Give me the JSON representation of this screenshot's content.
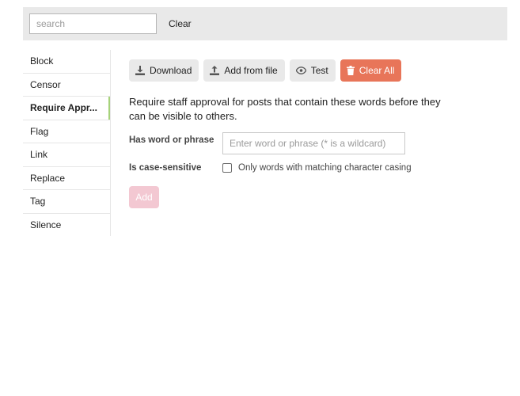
{
  "search": {
    "placeholder": "search",
    "value": "",
    "clear_label": "Clear"
  },
  "sidebar": {
    "active_index": 2,
    "items": [
      {
        "label": "Block"
      },
      {
        "label": "Censor"
      },
      {
        "label": "Require Appr..."
      },
      {
        "label": "Flag"
      },
      {
        "label": "Link"
      },
      {
        "label": "Replace"
      },
      {
        "label": "Tag"
      },
      {
        "label": "Silence"
      }
    ]
  },
  "toolbar": {
    "download_label": "Download",
    "add_from_file_label": "Add from file",
    "test_label": "Test",
    "clear_all_label": "Clear All"
  },
  "main": {
    "description": "Require staff approval for posts that contain these words before they can be visible to others.",
    "word_label": "Has word or phrase",
    "word_placeholder": "Enter word or phrase (* is a wildcard)",
    "word_value": "",
    "case_label": "Is case-sensitive",
    "case_checkbox_text": "Only words with matching character casing",
    "case_checked": false,
    "add_label": "Add"
  },
  "colors": {
    "topbar_bg": "#e9e9e9",
    "button_bg": "#e9e9e9",
    "danger": "#e45735",
    "active_indicator": "#a6d27a",
    "add_disabled": "#f3c8d2"
  }
}
